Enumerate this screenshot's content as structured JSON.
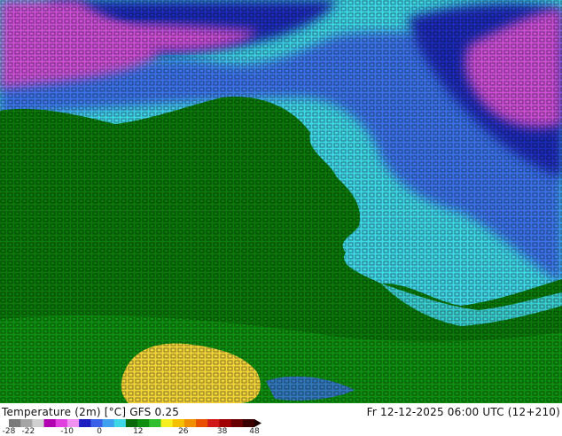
{
  "map": {
    "title": "Temperature (2m) [°C] GFS 0.25",
    "datetime": "Fr 12-12-2025 06:00 UTC (12+210)",
    "colors": {
      "land_green": "#0b7a0b",
      "sea_cyan": "#3fd6e6",
      "sea_blue": "#3a72e8",
      "deep_blue": "#1a2cb8",
      "cold_magenta": "#cc4fd6",
      "warm_yellow": "#f2d43a",
      "grid_text": "#000000"
    },
    "scale": {
      "min": -28,
      "max": 48,
      "tick_labels": [
        "-28",
        "-22",
        "-10",
        "0",
        "12",
        "26",
        "38",
        "48"
      ],
      "colors": [
        "#7a7a7a",
        "#a5a5a5",
        "#d0d0d0",
        "#b000b0",
        "#e040e0",
        "#f090f0",
        "#1c1cc0",
        "#3a60e8",
        "#3fa0f0",
        "#3fd6e6",
        "#0a6a0a",
        "#0f8f0f",
        "#2fbf2f",
        "#f7f020",
        "#f5c000",
        "#f09000",
        "#e85000",
        "#d01818",
        "#a00000",
        "#6a0000",
        "#3a0000"
      ]
    }
  }
}
